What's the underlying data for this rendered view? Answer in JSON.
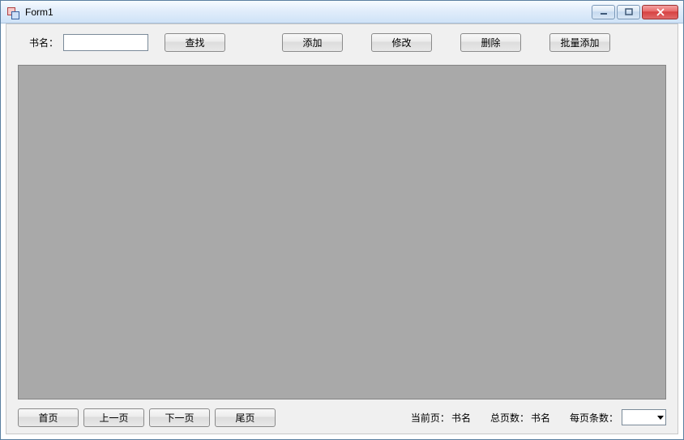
{
  "window": {
    "title": "Form1"
  },
  "top": {
    "book_label": "书名：",
    "search_value": "",
    "btn_search": "查找",
    "btn_add": "添加",
    "btn_edit": "修改",
    "btn_delete": "删除",
    "btn_batch": "批量添加"
  },
  "bottom": {
    "btn_first": "首页",
    "btn_prev": "上一页",
    "btn_next": "下一页",
    "btn_last": "尾页",
    "cur_page_label": "当前页：",
    "cur_page_value": "书名",
    "total_label": "总页数：",
    "total_value": "书名",
    "per_page_label": "每页条数：",
    "per_page_value": ""
  }
}
